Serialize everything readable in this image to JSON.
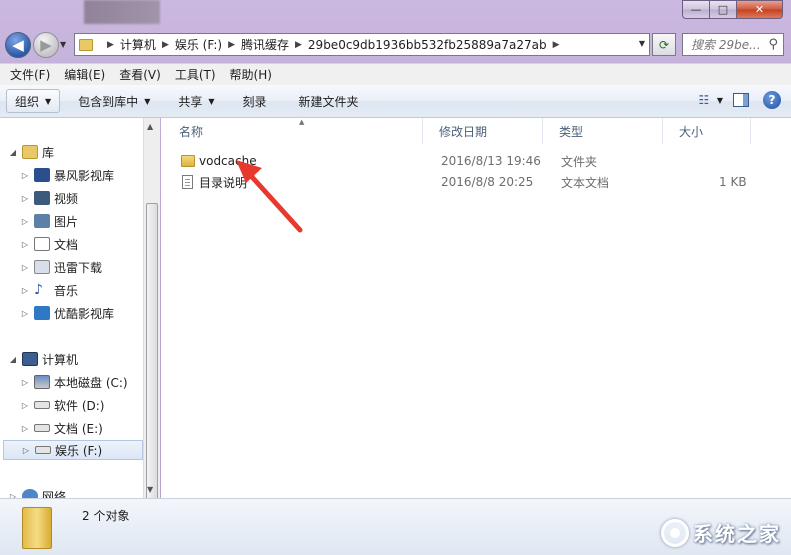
{
  "window": {
    "caption_min": "—",
    "caption_max": "□",
    "caption_close": "✕"
  },
  "address": {
    "crumbs": [
      "计算机",
      "娱乐 (F:)",
      "腾讯缓存",
      "29be0c9db1936bb532fb25889a7a27ab"
    ],
    "search_placeholder": "搜索 29be..."
  },
  "menu": [
    "文件(F)",
    "编辑(E)",
    "查看(V)",
    "工具(T)",
    "帮助(H)"
  ],
  "toolbar": {
    "organize": "组织",
    "include_in_library": "包含到库中",
    "share": "共享",
    "burn": "刻录",
    "new_folder": "新建文件夹"
  },
  "navpane": {
    "libraries": "库",
    "library_items": [
      "暴风影视库",
      "视频",
      "图片",
      "文档",
      "迅雷下载",
      "音乐",
      "优酷影视库"
    ],
    "computer": "计算机",
    "drives": [
      "本地磁盘 (C:)",
      "软件 (D:)",
      "文档 (E:)",
      "娱乐 (F:)"
    ],
    "network": "网络"
  },
  "columns": {
    "name": "名称",
    "modified": "修改日期",
    "type": "类型",
    "size": "大小"
  },
  "files": [
    {
      "name": "vodcache",
      "modified": "2016/8/13 19:46",
      "type": "文件夹",
      "size": ""
    },
    {
      "name": "目录说明",
      "modified": "2016/8/8 20:25",
      "type": "文本文档",
      "size": "1 KB"
    }
  ],
  "status": {
    "count": "2 个对象"
  },
  "watermark": {
    "text": "系统之家"
  },
  "colors": {
    "frame": "#cbb8e0",
    "arrow": "#e8392f",
    "accent": "#2d5aa8"
  }
}
